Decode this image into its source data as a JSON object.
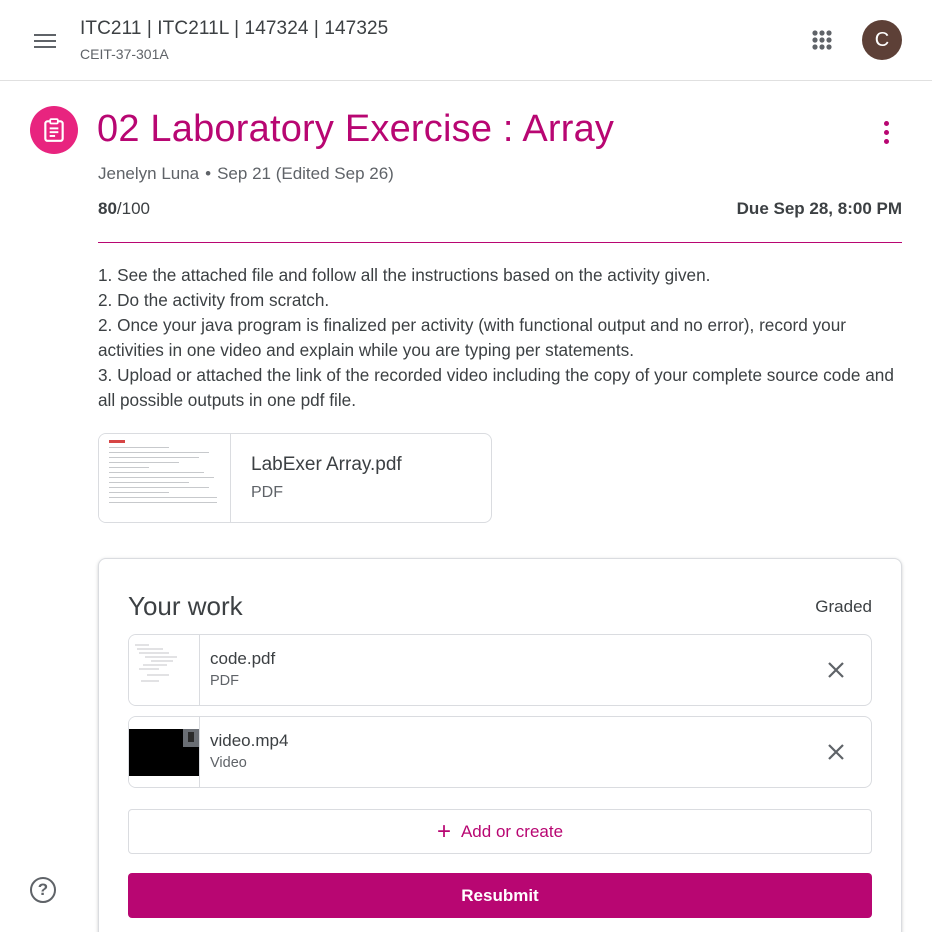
{
  "header": {
    "menu_icon": "hamburger-menu-icon",
    "class_title": "ITC211 | ITC211L | 147324 | 147325",
    "class_section": "CEIT-37-301A",
    "apps_icon": "google-apps-grid-icon",
    "avatar_letter": "C",
    "avatar_color": "#5d4037"
  },
  "assignment": {
    "icon": "assignment-clipboard-icon",
    "title": "02 Laboratory Exercise : Array",
    "author": "Jenelyn Luna",
    "separator": "•",
    "date": "Sep 21 (Edited Sep 26)",
    "points_earned": "80",
    "points_total": "/100",
    "due": "Due Sep 28, 8:00 PM",
    "more_icon": "more-vert-icon",
    "accent_color": "#b80672"
  },
  "instructions": [
    "1. See the attached file and follow all the instructions based on the activity given.",
    "2. Do the activity from scratch.",
    "2. Once your java program is finalized per activity (with functional output and no error), record your activities in one video and explain while you are typing per statements.",
    "3. Upload or attached the link of the recorded video including the copy of your complete source code and all possible outputs in one pdf file."
  ],
  "attachment": {
    "name": "LabExer Array.pdf",
    "type": "PDF"
  },
  "your_work": {
    "title": "Your work",
    "status": "Graded",
    "files": [
      {
        "name": "code.pdf",
        "type": "PDF",
        "remove_icon": "close-icon"
      },
      {
        "name": "video.mp4",
        "type": "Video",
        "remove_icon": "close-icon"
      }
    ],
    "add_label": "Add or create",
    "add_icon": "plus-icon",
    "resubmit_label": "Resubmit"
  },
  "help": {
    "icon": "help-circle-icon",
    "glyph": "?"
  }
}
